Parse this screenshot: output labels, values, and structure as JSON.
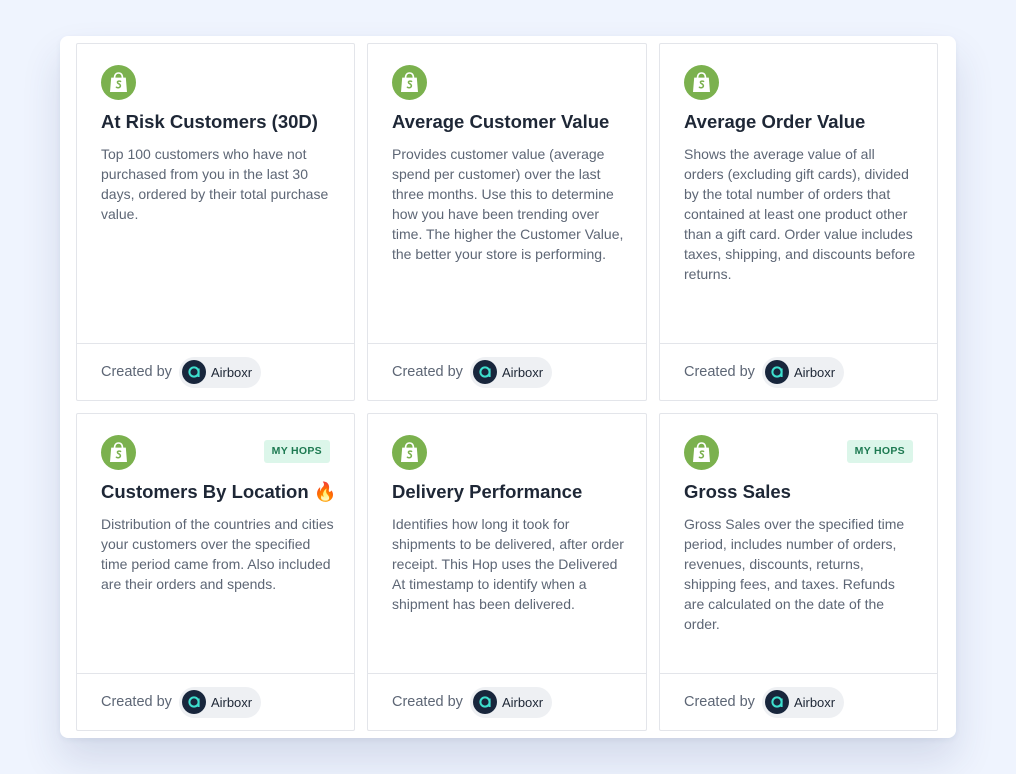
{
  "footer": {
    "created_by_label": "Created by",
    "author_name": "Airboxr"
  },
  "badge_label": "MY HOPS",
  "colors": {
    "shopify_green": "#7bb14e",
    "badge_bg": "#dcf6ea",
    "badge_text": "#1e7a52",
    "avatar_bg": "#18263c",
    "avatar_accent": "#3ee0cf"
  },
  "cards": [
    {
      "title": "At Risk Customers (30D)",
      "description": "Top 100 customers who have not purchased from you in the last 30 days, ordered by their total purchase value.",
      "icon": "shopify-icon",
      "badge": null
    },
    {
      "title": "Average Customer Value",
      "description": "Provides customer value (average spend per customer) over the last three months. Use this to determine how you have been trending over time. The higher the Customer Value, the better your store is performing.",
      "icon": "shopify-icon",
      "badge": null
    },
    {
      "title": "Average Order Value",
      "description": "Shows the average value of all orders (excluding gift cards), divided by the total number of orders that contained at least one product other than a gift card. Order value includes taxes, shipping, and discounts before returns.",
      "icon": "shopify-icon",
      "badge": null
    },
    {
      "title": "Customers By Location 🔥",
      "description": "Distribution of the countries and cities your customers over the specified time period came from. Also included are their orders and spends.",
      "icon": "shopify-icon",
      "badge": "MY HOPS"
    },
    {
      "title": "Delivery Performance",
      "description": "Identifies how long it took for shipments to be delivered, after order receipt. This Hop uses the Delivered At timestamp to identify when a shipment has been delivered.",
      "icon": "shopify-icon",
      "badge": null
    },
    {
      "title": "Gross Sales",
      "description": "Gross Sales over the specified time period, includes number of orders, revenues, discounts, returns, shipping fees, and taxes. Refunds are calculated on the date of the order.",
      "icon": "shopify-icon",
      "badge": "MY HOPS"
    }
  ]
}
